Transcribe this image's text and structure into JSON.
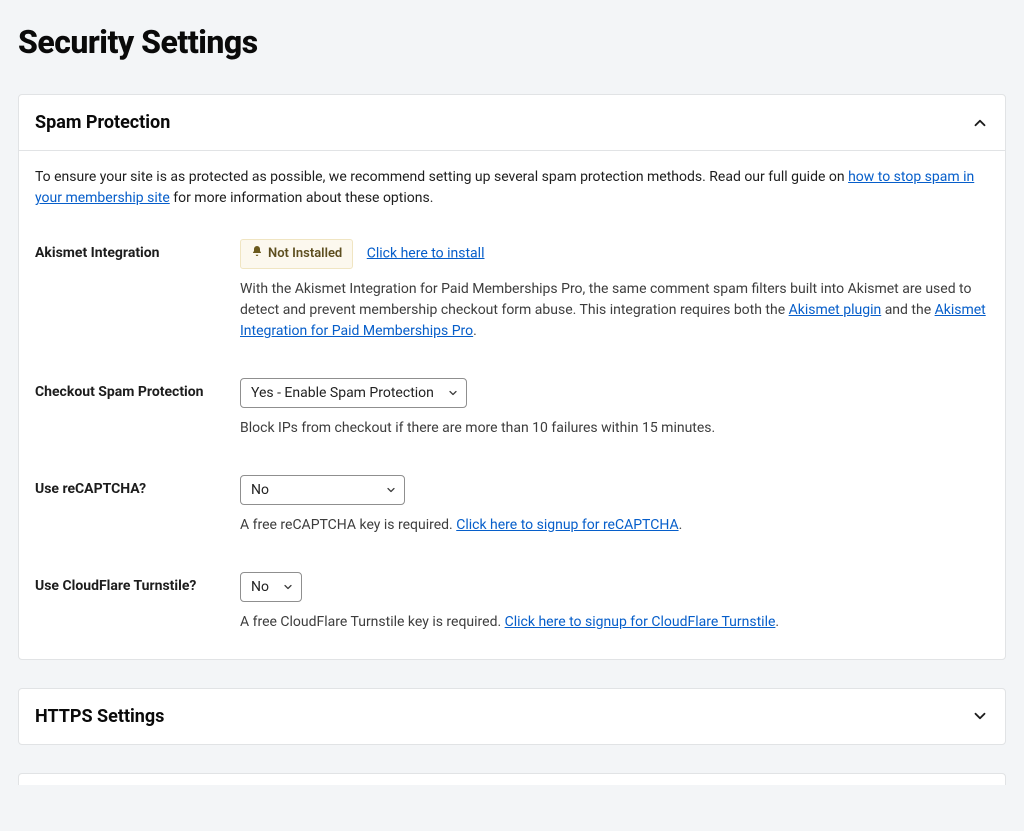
{
  "page": {
    "title": "Security Settings"
  },
  "sections": {
    "spam": {
      "title": "Spam Protection",
      "intro_pre": "To ensure your site is as protected as possible, we recommend setting up several spam protection methods. Read our full guide on ",
      "intro_link": "how to stop spam in your membership site",
      "intro_post": " for more information about these options.",
      "akismet": {
        "label": "Akismet Integration",
        "badge": "Not Installed",
        "install_link": "Click here to install",
        "desc_pre": "With the Akismet Integration for Paid Memberships Pro, the same comment spam filters built into Akismet are used to detect and prevent membership checkout form abuse. This integration requires both the ",
        "link1": "Akismet plugin",
        "desc_mid": " and the ",
        "link2": "Akismet Integration for Paid Memberships Pro",
        "desc_post": "."
      },
      "checkout": {
        "label": "Checkout Spam Protection",
        "value": "Yes - Enable Spam Protection",
        "desc": "Block IPs from checkout if there are more than 10 failures within 15 minutes."
      },
      "recaptcha": {
        "label": "Use reCAPTCHA?",
        "value": "No",
        "desc_pre": "A free reCAPTCHA key is required. ",
        "link": "Click here to signup for reCAPTCHA",
        "desc_post": "."
      },
      "turnstile": {
        "label": "Use CloudFlare Turnstile?",
        "value": "No",
        "desc_pre": "A free CloudFlare Turnstile key is required. ",
        "link": "Click here to signup for CloudFlare Turnstile",
        "desc_post": "."
      }
    },
    "https": {
      "title": "HTTPS Settings"
    }
  }
}
